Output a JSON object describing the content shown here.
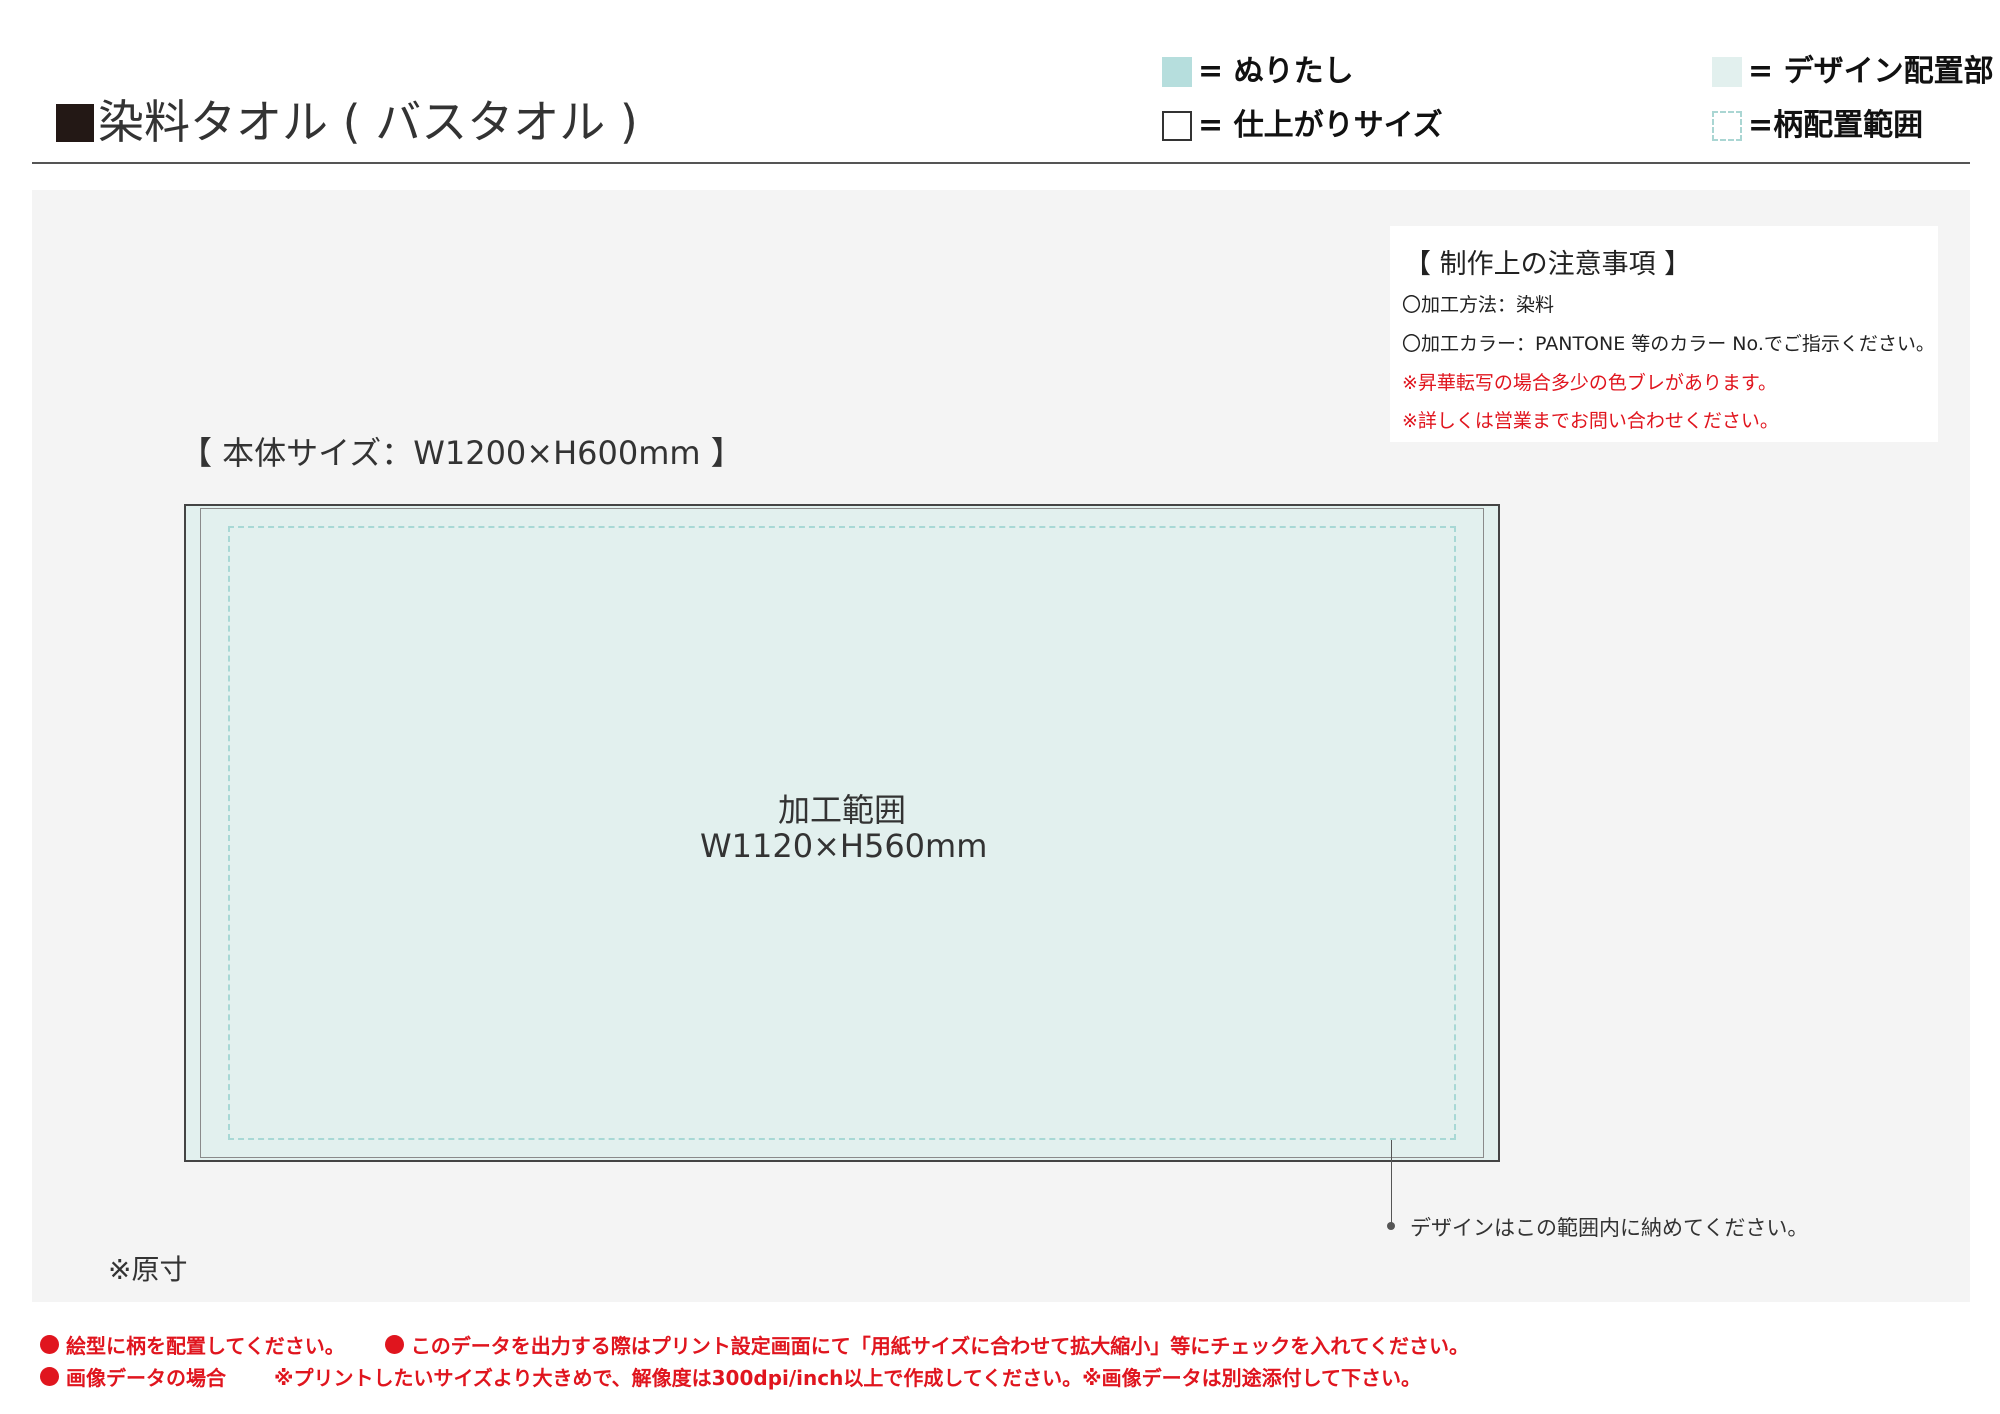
{
  "header": {
    "title": "染料タオル ( バスタオル )"
  },
  "legend": {
    "bleed": "= ぬりたし",
    "trim": "= 仕上がりサイズ",
    "design": "= デザイン配置部",
    "pattern": "=柄配置範囲"
  },
  "notes": {
    "title": "【 制作上の注意事項 】",
    "items": [
      "〇加工方法：染料",
      "〇加工カラー：PANTONE 等のカラー No.でご指示ください。",
      "※昇華転写の場合多少の色ブレがあります。",
      "※詳しくは営業までお問い合わせください。"
    ]
  },
  "diagram": {
    "body_size": "【 本体サイズ：W1200×H600mm 】",
    "area_label": "加工範囲",
    "area_size": "W1120×H560mm",
    "leader_text": "デザインはこの範囲内に納めてください。",
    "scale_note": "※原寸"
  },
  "footer": {
    "line1_a": "絵型に柄を配置してください。",
    "line1_b": "このデータを出力する際はプリント設定画面にて「用紙サイズに合わせて拡大縮小」等にチェックを入れてください。",
    "line2_a": "画像データの場合",
    "line2_b": "※プリントしたいサイズより大きめで、解像度は300dpi/inch以上で作成してください。※画像データは別途添付して下さい。"
  },
  "colors": {
    "bleed": "#b6dedd",
    "design_area": "#e2f0ee",
    "pattern_border": "#a8d8d5",
    "warning": "#e0151e",
    "panel": "#f4f4f4"
  }
}
